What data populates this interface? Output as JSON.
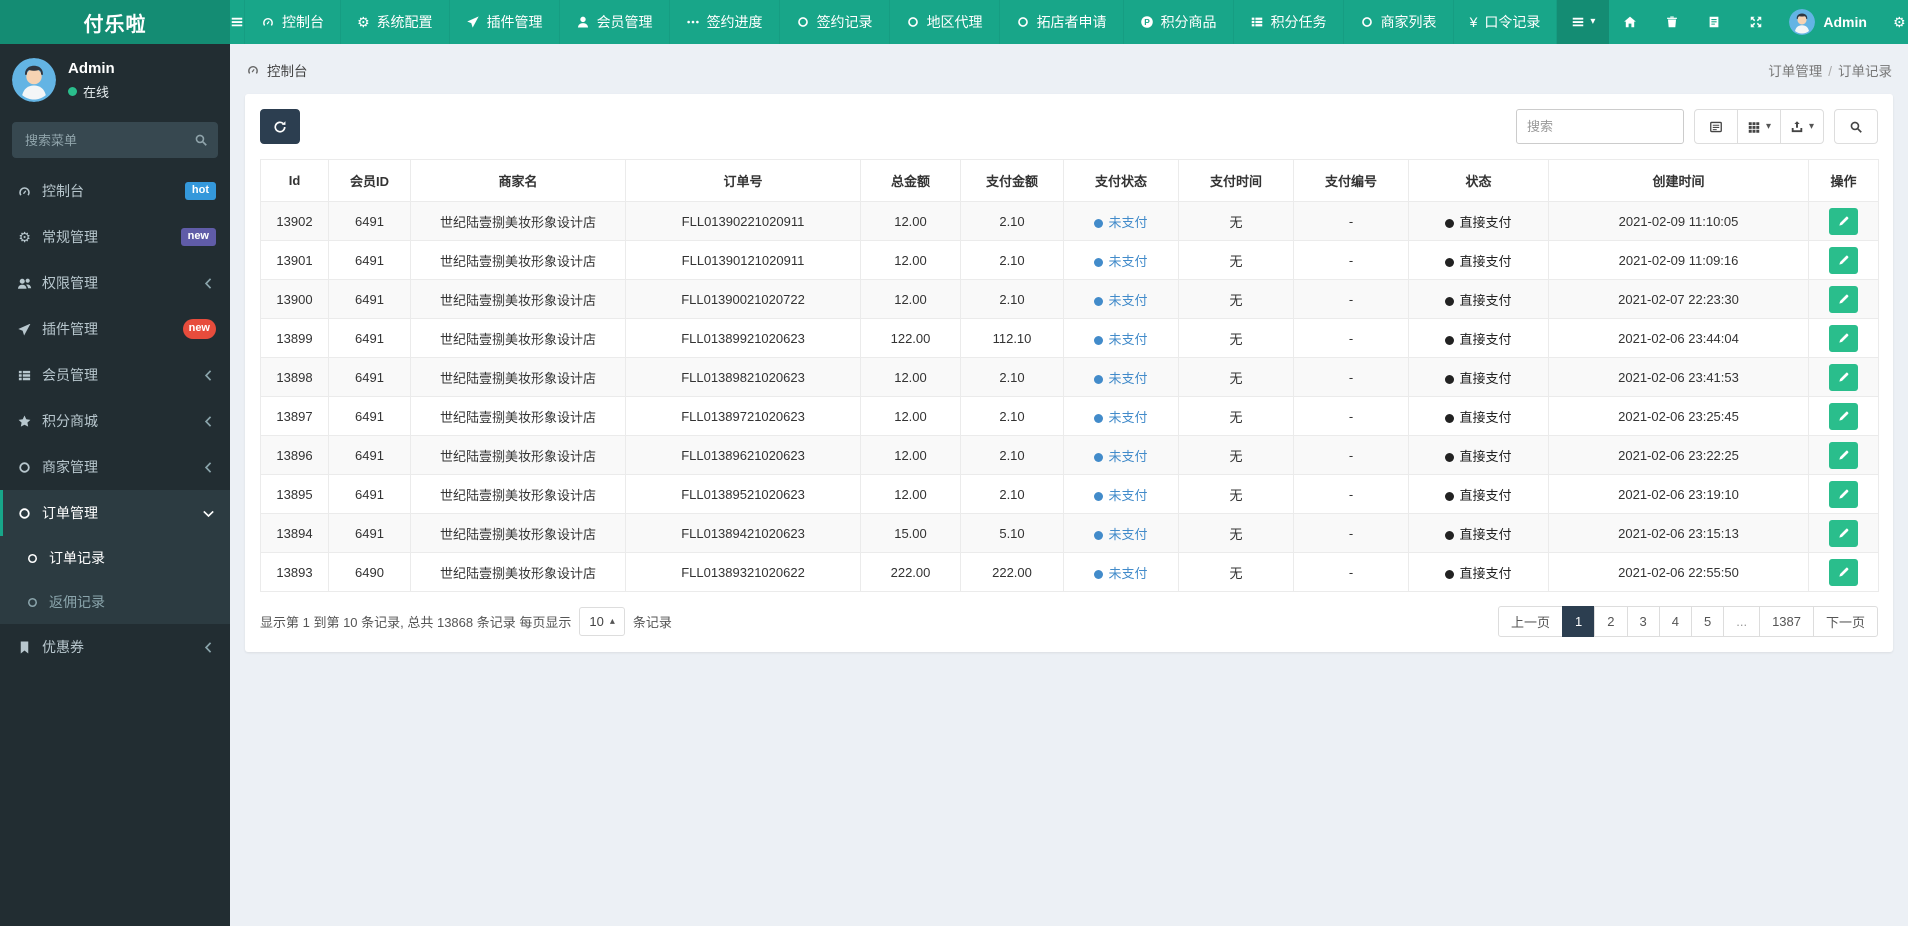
{
  "brand": "付乐啦",
  "colors": {
    "teal": "#18a689",
    "teal_dark": "#148c73",
    "navy": "#2c3e50",
    "green": "#2abe8c",
    "blue": "#428bca",
    "badge_blue": "#3498db",
    "badge_purple": "#605ca8",
    "badge_red": "#e74c3c",
    "sidebar": "#222d32",
    "sidebar_light": "#2c3b41",
    "content_bg": "#ecf0f5"
  },
  "navbar": {
    "items": [
      {
        "label": "控制台",
        "icon": "gauge"
      },
      {
        "label": "系统配置",
        "icon": "gear"
      },
      {
        "label": "插件管理",
        "icon": "send"
      },
      {
        "label": "会员管理",
        "icon": "user"
      },
      {
        "label": "签约进度",
        "icon": "ellipsis"
      },
      {
        "label": "签约记录",
        "icon": "circle"
      },
      {
        "label": "地区代理",
        "icon": "circle"
      },
      {
        "label": "拓店者申请",
        "icon": "circle"
      },
      {
        "label": "积分商品",
        "icon": "p-circle"
      },
      {
        "label": "积分任务",
        "icon": "list"
      },
      {
        "label": "商家列表",
        "icon": "circle"
      },
      {
        "label": "口令记录",
        "icon": "yen"
      }
    ],
    "utilities": [
      {
        "name": "menu-dropdown",
        "icon": "bars",
        "caret": true,
        "active": true
      },
      {
        "name": "home",
        "icon": "home"
      },
      {
        "name": "trash",
        "icon": "trash"
      },
      {
        "name": "log",
        "icon": "log"
      },
      {
        "name": "fullscreen",
        "icon": "expand"
      }
    ],
    "admin_label": "Admin",
    "admin_trailing_icon": "gear"
  },
  "sidebar": {
    "user": {
      "name": "Admin",
      "status": "在线"
    },
    "search_placeholder": "搜索菜单",
    "items": [
      {
        "label": "控制台",
        "icon": "gauge",
        "badge": {
          "text": "hot",
          "color": "#3498db"
        }
      },
      {
        "label": "常规管理",
        "icon": "gear",
        "badge": {
          "text": "new",
          "color": "#605ca8"
        }
      },
      {
        "label": "权限管理",
        "icon": "users",
        "chevron": "left"
      },
      {
        "label": "插件管理",
        "icon": "send",
        "badge": {
          "text": "new",
          "color": "#e74c3c",
          "round": true
        }
      },
      {
        "label": "会员管理",
        "icon": "list",
        "chevron": "left"
      },
      {
        "label": "积分商城",
        "icon": "star",
        "chevron": "left"
      },
      {
        "label": "商家管理",
        "icon": "circle",
        "chevron": "left"
      },
      {
        "label": "订单管理",
        "icon": "circle",
        "chevron": "down",
        "active": true,
        "children": [
          {
            "label": "订单记录",
            "active": true
          },
          {
            "label": "返佣记录",
            "active": false
          }
        ]
      },
      {
        "label": "优惠券",
        "icon": "bookmark",
        "chevron": "left"
      }
    ]
  },
  "breadcrumb": {
    "left": "控制台",
    "parent": "订单管理",
    "current": "订单记录"
  },
  "toolbar": {
    "search_placeholder": "搜索"
  },
  "table": {
    "columns": [
      "Id",
      "会员ID",
      "商家名",
      "订单号",
      "总金额",
      "支付金额",
      "支付状态",
      "支付时间",
      "支付编号",
      "状态",
      "创建时间",
      "操作"
    ],
    "rows": [
      {
        "id": "13902",
        "member_id": "6491",
        "merchant": "世纪陆壹捌美妆形象设计店",
        "order_no": "FLL01390221020911",
        "total": "12.00",
        "paid": "2.10",
        "pay_status": "未支付",
        "pay_time": "无",
        "pay_no": "-",
        "status": "直接支付",
        "created": "2021-02-09 11:10:05"
      },
      {
        "id": "13901",
        "member_id": "6491",
        "merchant": "世纪陆壹捌美妆形象设计店",
        "order_no": "FLL01390121020911",
        "total": "12.00",
        "paid": "2.10",
        "pay_status": "未支付",
        "pay_time": "无",
        "pay_no": "-",
        "status": "直接支付",
        "created": "2021-02-09 11:09:16"
      },
      {
        "id": "13900",
        "member_id": "6491",
        "merchant": "世纪陆壹捌美妆形象设计店",
        "order_no": "FLL01390021020722",
        "total": "12.00",
        "paid": "2.10",
        "pay_status": "未支付",
        "pay_time": "无",
        "pay_no": "-",
        "status": "直接支付",
        "created": "2021-02-07 22:23:30"
      },
      {
        "id": "13899",
        "member_id": "6491",
        "merchant": "世纪陆壹捌美妆形象设计店",
        "order_no": "FLL01389921020623",
        "total": "122.00",
        "paid": "112.10",
        "pay_status": "未支付",
        "pay_time": "无",
        "pay_no": "-",
        "status": "直接支付",
        "created": "2021-02-06 23:44:04"
      },
      {
        "id": "13898",
        "member_id": "6491",
        "merchant": "世纪陆壹捌美妆形象设计店",
        "order_no": "FLL01389821020623",
        "total": "12.00",
        "paid": "2.10",
        "pay_status": "未支付",
        "pay_time": "无",
        "pay_no": "-",
        "status": "直接支付",
        "created": "2021-02-06 23:41:53"
      },
      {
        "id": "13897",
        "member_id": "6491",
        "merchant": "世纪陆壹捌美妆形象设计店",
        "order_no": "FLL01389721020623",
        "total": "12.00",
        "paid": "2.10",
        "pay_status": "未支付",
        "pay_time": "无",
        "pay_no": "-",
        "status": "直接支付",
        "created": "2021-02-06 23:25:45"
      },
      {
        "id": "13896",
        "member_id": "6491",
        "merchant": "世纪陆壹捌美妆形象设计店",
        "order_no": "FLL01389621020623",
        "total": "12.00",
        "paid": "2.10",
        "pay_status": "未支付",
        "pay_time": "无",
        "pay_no": "-",
        "status": "直接支付",
        "created": "2021-02-06 23:22:25"
      },
      {
        "id": "13895",
        "member_id": "6491",
        "merchant": "世纪陆壹捌美妆形象设计店",
        "order_no": "FLL01389521020623",
        "total": "12.00",
        "paid": "2.10",
        "pay_status": "未支付",
        "pay_time": "无",
        "pay_no": "-",
        "status": "直接支付",
        "created": "2021-02-06 23:19:10"
      },
      {
        "id": "13894",
        "member_id": "6491",
        "merchant": "世纪陆壹捌美妆形象设计店",
        "order_no": "FLL01389421020623",
        "total": "15.00",
        "paid": "5.10",
        "pay_status": "未支付",
        "pay_time": "无",
        "pay_no": "-",
        "status": "直接支付",
        "created": "2021-02-06 23:15:13"
      },
      {
        "id": "13893",
        "member_id": "6490",
        "merchant": "世纪陆壹捌美妆形象设计店",
        "order_no": "FLL01389321020622",
        "total": "222.00",
        "paid": "222.00",
        "pay_status": "未支付",
        "pay_time": "无",
        "pay_no": "-",
        "status": "直接支付",
        "created": "2021-02-06 22:55:50"
      }
    ]
  },
  "pagination": {
    "summary_prefix": "显示第 1 到第 10 条记录, 总共 13868 条记录 每页显示",
    "summary_suffix": "条记录",
    "page_size": "10",
    "prev": "上一页",
    "next": "下一页",
    "pages": [
      "1",
      "2",
      "3",
      "4",
      "5",
      "...",
      "1387"
    ],
    "active_page": "1"
  }
}
